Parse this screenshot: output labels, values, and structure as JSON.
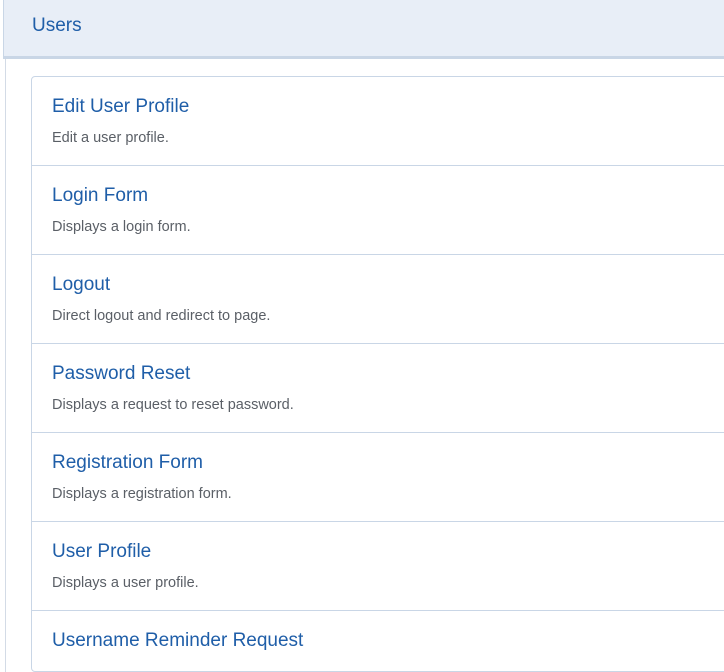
{
  "section": {
    "title": "Users"
  },
  "items": [
    {
      "title": "Edit User Profile",
      "description": "Edit a user profile."
    },
    {
      "title": "Login Form",
      "description": "Displays a login form."
    },
    {
      "title": "Logout",
      "description": "Direct logout and redirect to page."
    },
    {
      "title": "Password Reset",
      "description": "Displays a request to reset password."
    },
    {
      "title": "Registration Form",
      "description": "Displays a registration form."
    },
    {
      "title": "User Profile",
      "description": "Displays a user profile."
    },
    {
      "title": "Username Reminder Request",
      "description": ""
    }
  ],
  "colors": {
    "header_bg": "#e8eef7",
    "link": "#1f5ea8",
    "description": "#5a5f66",
    "border": "#c9d6e6"
  }
}
